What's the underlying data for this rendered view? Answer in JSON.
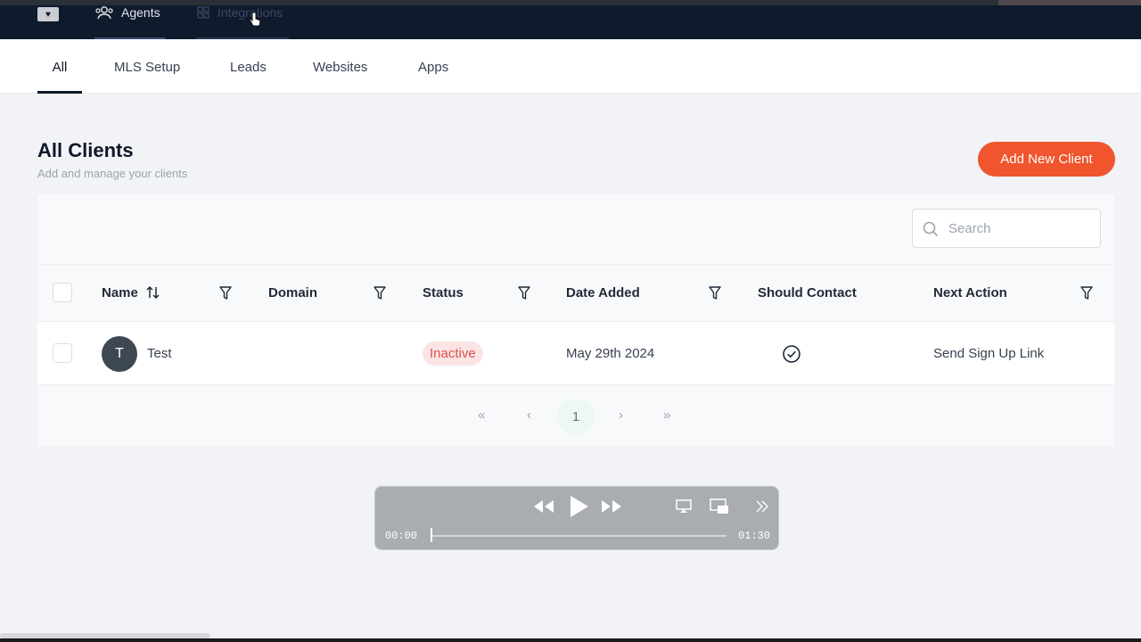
{
  "topnav": {
    "items": [
      {
        "label": "Agents",
        "icon": "users-icon"
      },
      {
        "label": "Integrations",
        "icon": "grid-icon"
      }
    ]
  },
  "tabs": [
    {
      "label": "All",
      "active": true
    },
    {
      "label": "MLS Setup"
    },
    {
      "label": "Leads"
    },
    {
      "label": "Websites"
    },
    {
      "label": "Apps"
    }
  ],
  "header": {
    "title": "All Clients",
    "subtitle": "Add and manage your clients",
    "add_button": "Add New Client"
  },
  "search": {
    "placeholder": "Search"
  },
  "table": {
    "columns": [
      "Name",
      "Domain",
      "Status",
      "Date Added",
      "Should Contact",
      "Next Action"
    ],
    "rows": [
      {
        "initial": "T",
        "name": "Test",
        "domain": "",
        "status": "Inactive",
        "date_added": "May 29th 2024",
        "should_contact": true,
        "next_action": "Send Sign Up Link"
      }
    ]
  },
  "pagination": {
    "first": "«",
    "prev": "‹",
    "current": "1",
    "next": "›",
    "last": "»"
  },
  "player": {
    "elapsed": "00:00",
    "duration": "01:30",
    "progress": 0
  },
  "colors": {
    "accent": "#f0552e",
    "nav_bg": "#0f1a2c",
    "inactive_bg": "#fbe4e4",
    "inactive_text": "#d9534f"
  }
}
